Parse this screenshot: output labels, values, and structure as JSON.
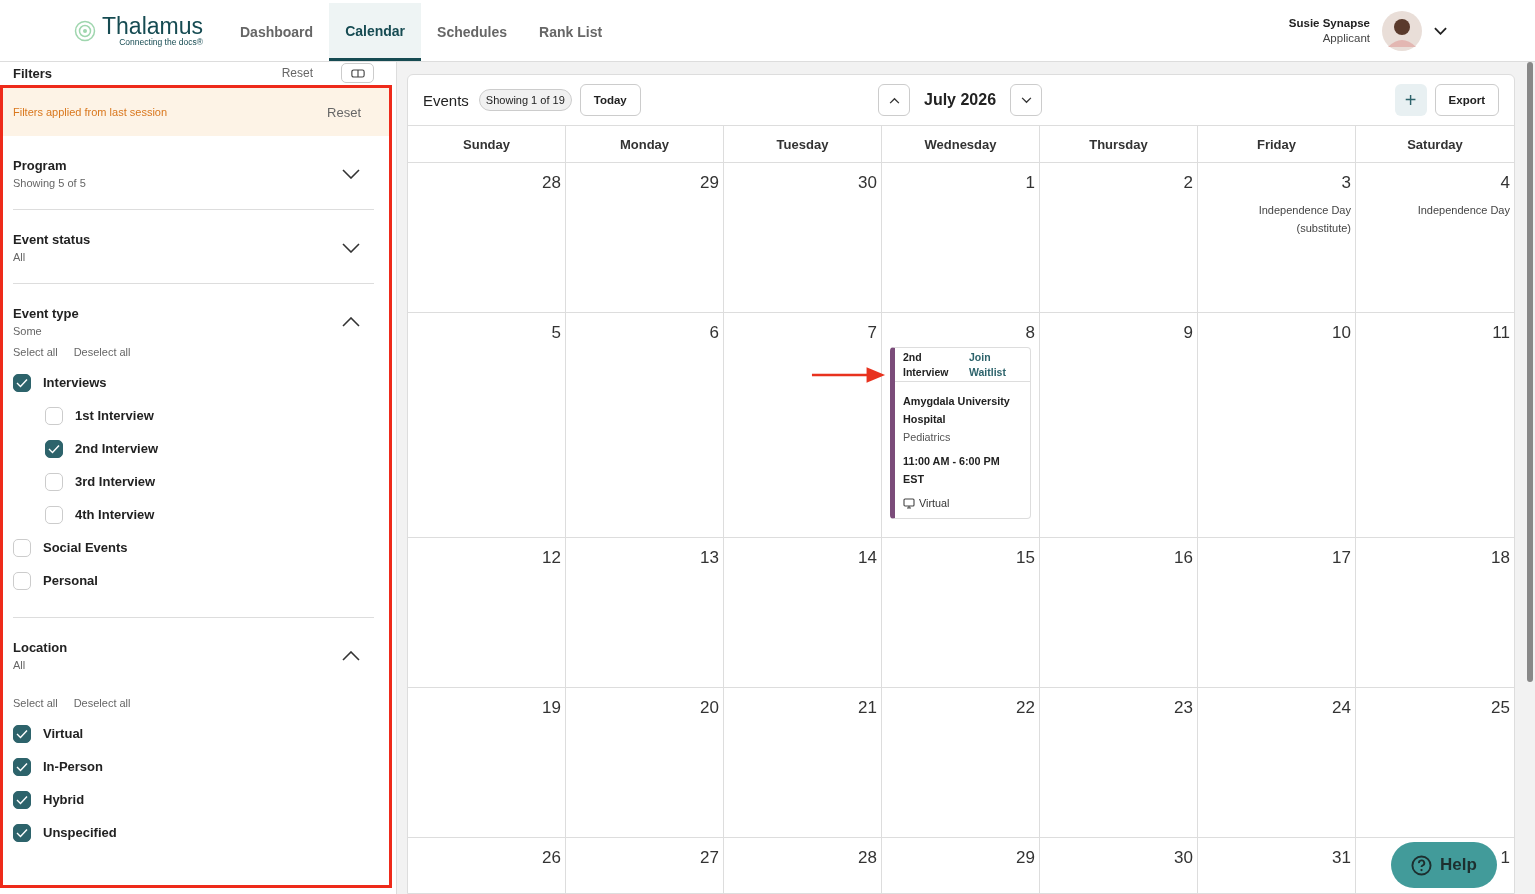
{
  "nav": {
    "logo": {
      "name": "Thalamus",
      "tagline": "Connecting the docs®"
    },
    "tabs": [
      {
        "label": "Dashboard",
        "selected": false
      },
      {
        "label": "Calendar",
        "selected": true
      },
      {
        "label": "Schedules",
        "selected": false
      },
      {
        "label": "Rank List",
        "selected": false
      }
    ],
    "user": {
      "name": "Susie Synapse",
      "role": "Applicant"
    }
  },
  "filters": {
    "title": "Filters",
    "reset": "Reset",
    "banner": {
      "text": "Filters applied from last session",
      "action": "Reset"
    },
    "sections": [
      {
        "title": "Program",
        "summary": "Showing 5 of 5",
        "expanded": false
      },
      {
        "title": "Event status",
        "summary": "All",
        "expanded": false
      },
      {
        "title": "Event type",
        "summary": "Some",
        "expanded": true,
        "actions": [
          "Select all",
          "Deselect all"
        ],
        "options": [
          {
            "label": "Interviews",
            "checked": true,
            "children": [
              {
                "label": "1st Interview",
                "checked": false
              },
              {
                "label": "2nd Interview",
                "checked": true
              },
              {
                "label": "3rd Interview",
                "checked": false
              },
              {
                "label": "4th Interview",
                "checked": false
              }
            ]
          },
          {
            "label": "Social Events",
            "checked": false
          },
          {
            "label": "Personal",
            "checked": false
          }
        ]
      },
      {
        "title": "Location",
        "summary": "All",
        "expanded": true,
        "actions": [
          "Select all",
          "Deselect all"
        ],
        "options": [
          {
            "label": "Virtual",
            "checked": true
          },
          {
            "label": "In-Person",
            "checked": true
          },
          {
            "label": "Hybrid",
            "checked": true
          },
          {
            "label": "Unspecified",
            "checked": true
          }
        ]
      }
    ]
  },
  "calendar": {
    "title": "Events",
    "count": "Showing 1 of 19",
    "today": "Today",
    "month": "July 2026",
    "add": "+",
    "export": "Export",
    "weekdays": [
      "Sunday",
      "Monday",
      "Tuesday",
      "Wednesday",
      "Thursday",
      "Friday",
      "Saturday"
    ],
    "weeks": [
      [
        {
          "day": "28"
        },
        {
          "day": "29"
        },
        {
          "day": "30"
        },
        {
          "day": "1"
        },
        {
          "day": "2"
        },
        {
          "day": "3",
          "holiday": "Independence Day (substitute)"
        },
        {
          "day": "4",
          "holiday": "Independence Day"
        }
      ],
      [
        {
          "day": "5"
        },
        {
          "day": "6"
        },
        {
          "day": "7"
        },
        {
          "day": "8",
          "events": [
            {
              "type": "2nd Interview",
              "action": "Join Waitlist",
              "program": "Amygdala University Hospital",
              "specialty": "Pediatrics",
              "time": "11:00 AM - 6:00 PM EST",
              "location": "Virtual"
            }
          ]
        },
        {
          "day": "9"
        },
        {
          "day": "10"
        },
        {
          "day": "11"
        }
      ],
      [
        {
          "day": "12"
        },
        {
          "day": "13"
        },
        {
          "day": "14"
        },
        {
          "day": "15"
        },
        {
          "day": "16"
        },
        {
          "day": "17"
        },
        {
          "day": "18"
        }
      ],
      [
        {
          "day": "19"
        },
        {
          "day": "20"
        },
        {
          "day": "21"
        },
        {
          "day": "22"
        },
        {
          "day": "23"
        },
        {
          "day": "24"
        },
        {
          "day": "25"
        }
      ],
      [
        {
          "day": "26"
        },
        {
          "day": "27"
        },
        {
          "day": "28"
        },
        {
          "day": "29"
        },
        {
          "day": "30"
        },
        {
          "day": "31"
        },
        {
          "day": "1"
        }
      ]
    ]
  },
  "help": {
    "label": "Help"
  }
}
